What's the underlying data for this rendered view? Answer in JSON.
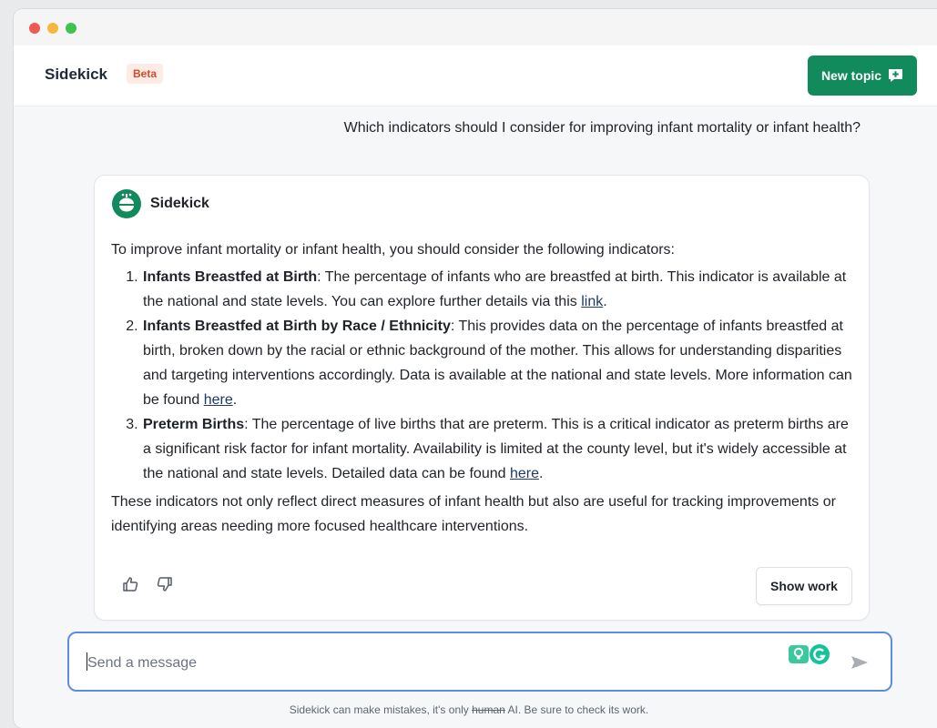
{
  "header": {
    "brand": "Sidekick",
    "badge": "Beta",
    "new_topic_label": "New topic"
  },
  "conversation": {
    "user_message": "Which indicators should I consider for improving infant mortality or infant health?",
    "assistant": {
      "name": "Sidekick",
      "intro": "To improve infant mortality or infant health, you should consider the following indicators:",
      "items": [
        {
          "title": "Infants Breastfed at Birth",
          "text": ": The percentage of infants who are breastfed at birth. This indicator is available at the national and state levels. You can explore further details via this ",
          "link": "link",
          "after": "."
        },
        {
          "title": "Infants Breastfed at Birth by Race / Ethnicity",
          "text": ": This provides data on the percentage of infants breastfed at birth, broken down by the racial or ethnic background of the mother. This allows for understanding disparities and targeting interventions accordingly. Data is available at the national and state levels. More information can be found ",
          "link": "here",
          "after": "."
        },
        {
          "title": "Preterm Births",
          "text": ": The percentage of live births that are preterm. This is a critical indicator as preterm births are a significant risk factor for infant mortality. Availability is limited at the county level, but it's widely accessible at the national and state levels. Detailed data can be found ",
          "link": "here",
          "after": "."
        }
      ],
      "closing": "These indicators not only reflect direct measures of infant health but also are useful for tracking improvements or identifying areas needing more focused healthcare interventions.",
      "show_work_label": "Show work"
    }
  },
  "composer": {
    "placeholder": "Send a message"
  },
  "disclaimer": {
    "before": "Sidekick can make mistakes, it's only ",
    "struck": "human",
    "after": " AI. Be sure to check its work."
  },
  "colors": {
    "accent": "#118a5c",
    "beta_bg": "#fdebe5",
    "beta_text": "#d24a2c",
    "input_border": "#5b8de5",
    "link": "#1d3a6a"
  },
  "icons": [
    "chat-plus-icon",
    "sidekick-bot-icon",
    "thumbs-up-icon",
    "thumbs-down-icon",
    "hint-bulb-icon",
    "grammarly-icon",
    "send-icon"
  ]
}
